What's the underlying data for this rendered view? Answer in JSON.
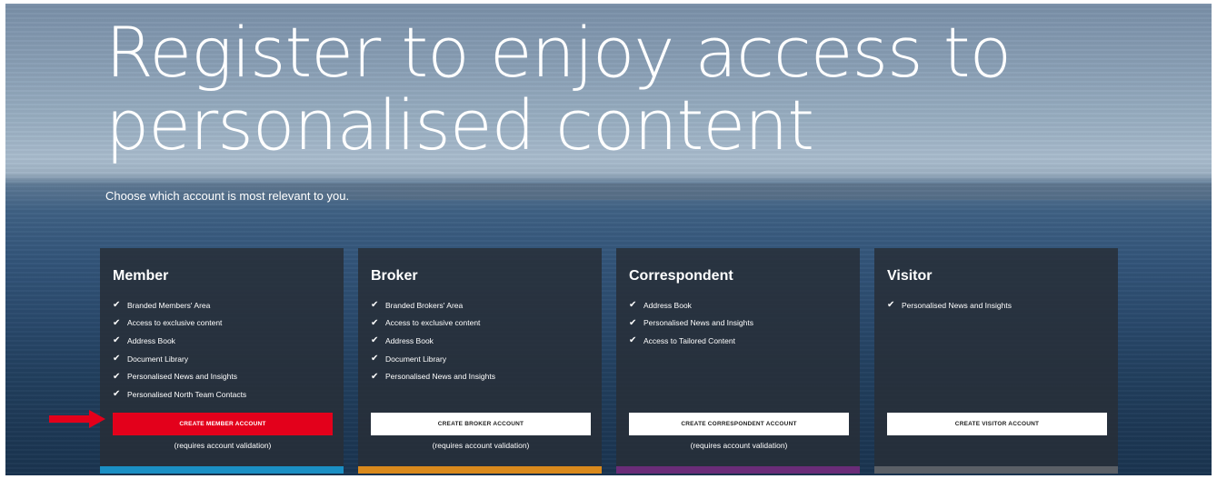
{
  "hero": {
    "headline_line1": "Register to enjoy access to",
    "headline_line2": "personalised content",
    "subtitle": "Choose which account is most relevant to you."
  },
  "cards": [
    {
      "title": "Member",
      "features": [
        "Branded Members' Area",
        "Access to exclusive content",
        "Address Book",
        "Document Library",
        "Personalised News and Insights",
        "Personalised North Team Contacts"
      ],
      "button_label": "CREATE MEMBER ACCOUNT",
      "note": "(requires account validation)",
      "accent_color": "#1a8fc4",
      "button_color": "#e3001b"
    },
    {
      "title": "Broker",
      "features": [
        "Branded Brokers' Area",
        "Access to exclusive content",
        "Address Book",
        "Document Library",
        "Personalised News and Insights"
      ],
      "button_label": "CREATE BROKER ACCOUNT",
      "note": "(requires account validation)",
      "accent_color": "#d9891c"
    },
    {
      "title": "Correspondent",
      "features": [
        "Address Book",
        "Personalised News and Insights",
        "Access to Tailored Content"
      ],
      "button_label": "CREATE CORRESPONDENT ACCOUNT",
      "note": "(requires account validation)",
      "accent_color": "#6a2c78"
    },
    {
      "title": "Visitor",
      "features": [
        "Personalised News and Insights"
      ],
      "button_label": "CREATE VISITOR ACCOUNT",
      "accent_color": "#5a5f66"
    }
  ],
  "annotation": {
    "icon": "red-arrow-icon",
    "color": "#e3001b"
  },
  "icons": {
    "check": "checkmark-icon"
  }
}
